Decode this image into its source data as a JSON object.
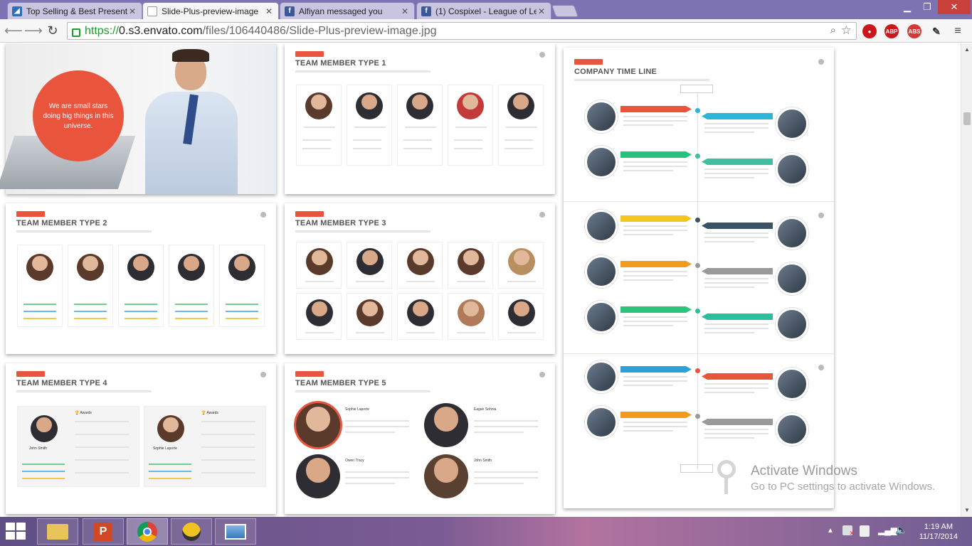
{
  "browser": {
    "tabs": [
      {
        "title": "Top Selling & Best Present",
        "icon": "envato-icon",
        "active": false
      },
      {
        "title": "Slide-Plus-preview-image",
        "icon": "page-icon",
        "active": true
      },
      {
        "title": "Alfiyan messaged you",
        "icon": "facebook-icon",
        "active": false
      },
      {
        "title": "(1) Cospixel - League of Le",
        "icon": "facebook-icon",
        "active": false
      }
    ],
    "url_protocol": "https://",
    "url_host": "0.s3.envato.com",
    "url_path": "/files/106440486/Slide-Plus-preview-image.jpg",
    "extensions": [
      "ABP",
      "ABS"
    ]
  },
  "slides": {
    "hero_text": "We are small stars doing big things in this universe.",
    "type1": "TEAM MEMBER TYPE 1",
    "type2": "TEAM MEMBER TYPE 2",
    "type3": "TEAM MEMBER TYPE 3",
    "type4": "TEAM MEMBER TYPE 4",
    "type5": "TEAM MEMBER TYPE 5",
    "timeline": "COMPANY TIME LINE",
    "type4_awards": "Awards",
    "type4_names": [
      "John Smith",
      "Sophie Laporte"
    ],
    "type5_names": [
      "Sophie Laporte",
      "Eagan Sohnia",
      "Owen Tracy",
      "John Smith"
    ]
  },
  "timeline_colors": [
    "#e8553c",
    "#2bb5d8",
    "#27c27b",
    "#3fbfa0",
    "#f4c51f",
    "#3a5266",
    "#f29a1e",
    "#9a9a9a",
    "#2bc47a",
    "#2bbd9c",
    "#2e9fd8",
    "#e8553c",
    "#f29a1e",
    "#9a9a9a"
  ],
  "watermark": {
    "line1": "Activate Windows",
    "line2": "Go to PC settings to activate Windows."
  },
  "taskbar": {
    "time": "1:19 AM",
    "date": "11/17/2014",
    "apps": [
      "file-explorer-icon",
      "powerpoint-icon",
      "chrome-icon",
      "bee-app-icon",
      "photo-viewer-icon"
    ]
  }
}
